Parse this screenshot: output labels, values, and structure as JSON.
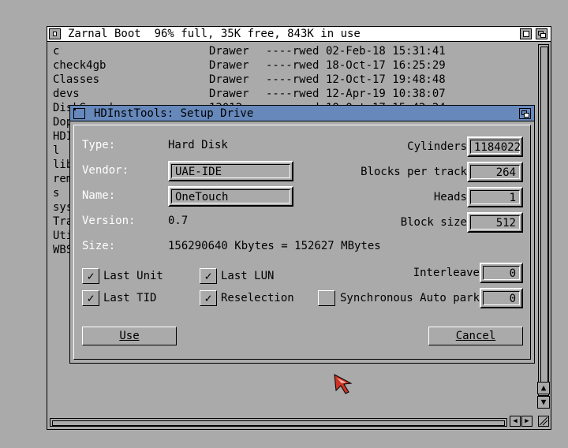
{
  "drawer": {
    "title": "Zarnal Boot  96% full, 35K free, 843K in use",
    "files": [
      {
        "name": "c",
        "kind": "Drawer",
        "prot": "----rwed",
        "date": "02-Feb-18 15:31:41"
      },
      {
        "name": "check4gb",
        "kind": "Drawer",
        "prot": "----rwed",
        "date": "18-Oct-17 16:25:29"
      },
      {
        "name": "Classes",
        "kind": "Drawer",
        "prot": "----rwed",
        "date": "12-Oct-17 19:48:48"
      },
      {
        "name": "devs",
        "kind": "Drawer",
        "prot": "----rwed",
        "date": "12-Apr-19 10:38:07"
      },
      {
        "name": "DiskSpeed",
        "kind": "13012",
        "prot": "----rwed",
        "date": "18-Oct-17 15:42:24"
      },
      {
        "name": "Dop",
        "kind": "",
        "prot": "",
        "date": ""
      },
      {
        "name": "HDI",
        "kind": "",
        "prot": "",
        "date": ""
      },
      {
        "name": "l",
        "kind": "",
        "prot": "",
        "date": ""
      },
      {
        "name": "lib",
        "kind": "",
        "prot": "",
        "date": ""
      },
      {
        "name": "rem",
        "kind": "",
        "prot": "",
        "date": ""
      },
      {
        "name": "s",
        "kind": "",
        "prot": "",
        "date": ""
      },
      {
        "name": "sys",
        "kind": "",
        "prot": "",
        "date": ""
      },
      {
        "name": "Tra",
        "kind": "",
        "prot": "",
        "date": ""
      },
      {
        "name": "Uti",
        "kind": "",
        "prot": "",
        "date": ""
      },
      {
        "name": "WBS",
        "kind": "",
        "prot": "",
        "date": ""
      }
    ],
    "scroll_up": "▲",
    "scroll_down": "▼",
    "scroll_left": "◀",
    "scroll_right": "▶"
  },
  "dialog": {
    "title": "HDInstTools: Setup Drive",
    "type_label": "Type:",
    "type_value": "Hard Disk",
    "vendor_label": "Vendor:",
    "vendor_value": "UAE-IDE",
    "name_label": "Name:",
    "name_value": "OneTouch",
    "version_label": "Version:",
    "version_value": "0.7",
    "size_label": "Size:",
    "size_value": "156290640 Kbytes = 152627 MBytes",
    "cylinders_label": "Cylinders",
    "cylinders_value": "1184022",
    "blocks_label": "Blocks per track",
    "blocks_value": "264",
    "heads_label": "Heads",
    "heads_value": "1",
    "blocksize_label": "Block size",
    "blocksize_value": "512",
    "interleave_label": "Interleave",
    "interleave_value": "0",
    "autopark_label": "Auto park",
    "autopark_value": "0",
    "checkboxes": {
      "last_unit": {
        "label": "Last Unit",
        "checked": true,
        "mark": "✓"
      },
      "last_lun": {
        "label": "Last LUN",
        "checked": true,
        "mark": "✓"
      },
      "last_tid": {
        "label": "Last TID",
        "checked": true,
        "mark": "✓"
      },
      "reselection": {
        "label": "Reselection",
        "checked": true,
        "mark": "✓"
      },
      "synchronous": {
        "label": "Synchronous",
        "checked": false,
        "mark": ""
      }
    },
    "use_button": "Use",
    "cancel_button": "Cancel"
  },
  "colors": {
    "desktop": "#aaaaaa",
    "title_active": "#6688bb",
    "highlight_text": "#ffffff",
    "pointer": "#cc3322"
  }
}
